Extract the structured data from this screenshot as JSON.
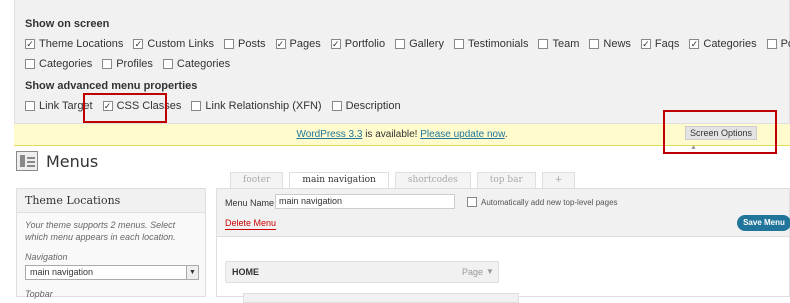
{
  "screen_options": {
    "show_on_screen_heading": "Show on screen",
    "show_on_screen_items": [
      {
        "label": "Theme Locations",
        "checked": true
      },
      {
        "label": "Custom Links",
        "checked": true
      },
      {
        "label": "Posts",
        "checked": false
      },
      {
        "label": "Pages",
        "checked": true
      },
      {
        "label": "Portfolio",
        "checked": true
      },
      {
        "label": "Gallery",
        "checked": false
      },
      {
        "label": "Testimonials",
        "checked": false
      },
      {
        "label": "Team",
        "checked": false
      },
      {
        "label": "News",
        "checked": false
      },
      {
        "label": "Faqs",
        "checked": true
      },
      {
        "label": "Categories",
        "checked": true
      },
      {
        "label": "Post Tags",
        "checked": false
      }
    ],
    "show_on_screen_items_row2": [
      {
        "label": "Categories",
        "checked": false
      },
      {
        "label": "Profiles",
        "checked": false
      },
      {
        "label": "Categories",
        "checked": false
      }
    ],
    "advanced_heading": "Show advanced menu properties",
    "advanced_items": [
      {
        "label": "Link Target",
        "checked": false
      },
      {
        "label": "CSS Classes",
        "checked": true
      },
      {
        "label": "Link Relationship (XFN)",
        "checked": false
      },
      {
        "label": "Description",
        "checked": false
      }
    ],
    "tab_label": "Screen Options",
    "tab_arrow": "▲"
  },
  "notice": {
    "version_link": "WordPress 3.3",
    "middle_text": " is available! ",
    "update_link": "Please update now",
    "end_text": "."
  },
  "page": {
    "title": "Menus"
  },
  "tabs": [
    "footer",
    "main navigation",
    "shortcodes",
    "top bar",
    "+"
  ],
  "sidebar": {
    "title": "Theme Locations",
    "description": "Your theme supports 2 menus. Select which menu appears in each location.",
    "navigation_label": "Navigation",
    "navigation_value": "main navigation",
    "topbar_label": "Topbar"
  },
  "editor": {
    "menu_name_label": "Menu Name",
    "menu_name_value": "main navigation",
    "auto_add_label": "Automatically add new top-level pages",
    "delete_label": "Delete Menu",
    "save_label": "Save Menu",
    "item_title": "HOME",
    "item_type": "Page",
    "item_arrow": "▼"
  },
  "colors": {
    "highlight": "#c00000",
    "primary": "#21759b",
    "notice_bg": "#fffbcc"
  }
}
